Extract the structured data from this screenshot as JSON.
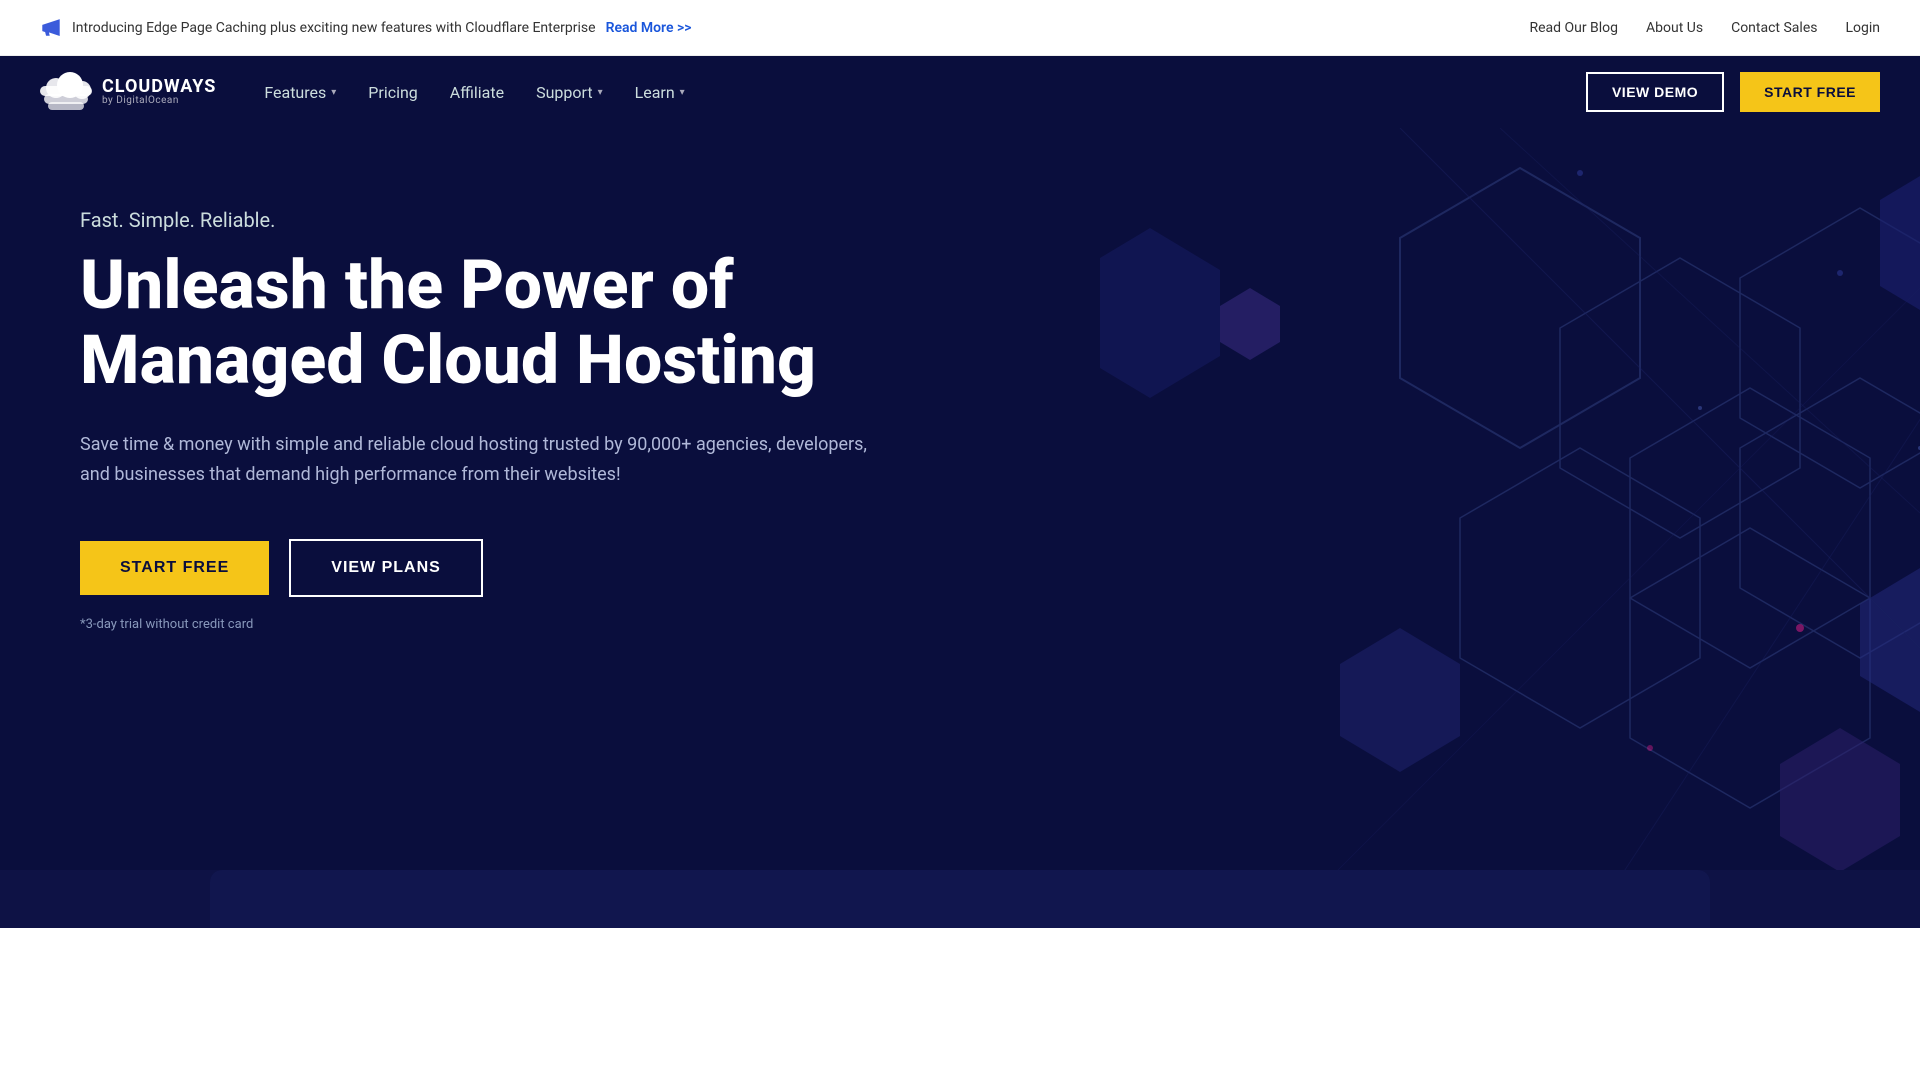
{
  "topbar": {
    "announcement": "Introducing Edge Page Caching plus exciting new features with Cloudflare Enterprise",
    "read_more_label": "Read More >>",
    "links": [
      {
        "label": "Read Our Blog",
        "name": "read-our-blog-link"
      },
      {
        "label": "About Us",
        "name": "about-us-link"
      },
      {
        "label": "Contact Sales",
        "name": "contact-sales-link"
      },
      {
        "label": "Login",
        "name": "login-link"
      }
    ]
  },
  "navbar": {
    "logo_main": "CLOUDWAYS",
    "logo_sub": "by DigitalOcean",
    "nav_items": [
      {
        "label": "Features",
        "has_dropdown": true,
        "name": "features-nav"
      },
      {
        "label": "Pricing",
        "has_dropdown": false,
        "name": "pricing-nav"
      },
      {
        "label": "Affiliate",
        "has_dropdown": false,
        "name": "affiliate-nav"
      },
      {
        "label": "Support",
        "has_dropdown": true,
        "name": "support-nav"
      },
      {
        "label": "Learn",
        "has_dropdown": true,
        "name": "learn-nav"
      }
    ],
    "view_demo_label": "VIEW DEMO",
    "start_free_label": "START FREE"
  },
  "hero": {
    "tagline": "Fast. Simple. Reliable.",
    "heading_line1": "Unleash the Power of",
    "heading_line2": "Managed Cloud Hosting",
    "description": "Save time & money with simple and reliable cloud hosting trusted by 90,000+ agencies, developers, and businesses that demand high performance from their websites!",
    "start_free_label": "START FREE",
    "view_plans_label": "VIEW PLANS",
    "trial_note": "*3-day trial without credit card"
  },
  "colors": {
    "bg_dark": "#0a0e3d",
    "yellow": "#f5c518",
    "white": "#ffffff",
    "text_muted": "#b0b8d8"
  }
}
